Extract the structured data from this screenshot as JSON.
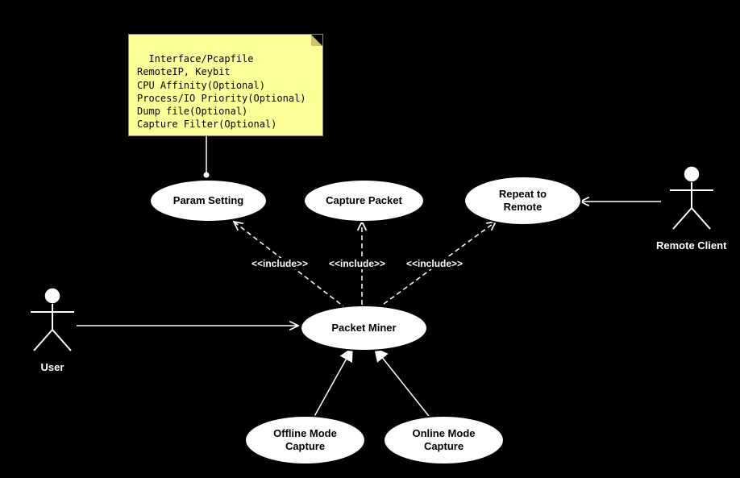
{
  "note": {
    "line1": "Interface/Pcapfile",
    "line2": "RemoteIP, Keybit",
    "line3": "CPU Affinity(Optional)",
    "line4": "Process/IO Priority(Optional)",
    "line5": "Dump file(Optional)",
    "line6": "Capture Filter(Optional)"
  },
  "usecases": {
    "param_setting": "Param Setting",
    "capture_packet": "Capture Packet",
    "repeat_remote": "Repeat to\nRemote",
    "packet_miner": "Packet Miner",
    "offline_mode": "Offline Mode\nCapture",
    "online_mode": "Online Mode\nCapture"
  },
  "actors": {
    "user": "User",
    "remote_client": "Remote Client"
  },
  "stereotypes": {
    "include1": "<<include>>",
    "include2": "<<include>>",
    "include3": "<<include>>"
  }
}
